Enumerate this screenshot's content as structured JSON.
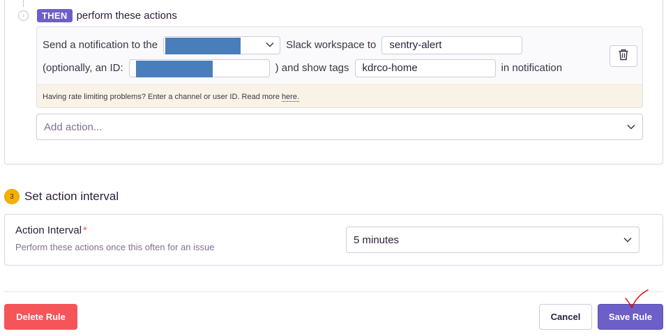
{
  "then_section": {
    "badge": "THEN",
    "title": "perform these actions",
    "slack_action": {
      "send_label": "Send a notification to the",
      "workspace_label": "Slack workspace to",
      "workspace_channel_value": "sentry-alert",
      "optional_id_label": "(optionally, an ID:",
      "show_tags_label": ") and show tags",
      "tags_value": "kdrco-home",
      "in_notification_label": "in notification",
      "rate_limit_text": "Having rate limiting problems? Enter a channel or user ID. Read more",
      "rate_limit_link": "here."
    },
    "add_action_placeholder": "Add action..."
  },
  "step3": {
    "number": "3",
    "title": "Set action interval"
  },
  "interval": {
    "label": "Action Interval",
    "required_mark": "*",
    "help": "Perform these actions once this often for an issue",
    "selected": "5 minutes"
  },
  "footer": {
    "delete_label": "Delete Rule",
    "cancel_label": "Cancel",
    "save_label": "Save Rule"
  },
  "colors": {
    "accent": "#6c5fc7",
    "danger": "#f55459",
    "step_badge": "#f5b000",
    "redaction": "#4a7ebb",
    "annotation": "#e00000"
  }
}
